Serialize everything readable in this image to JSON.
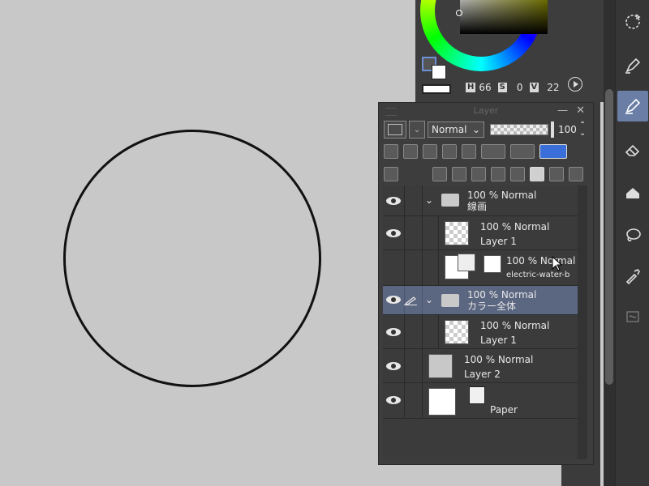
{
  "color_panel": {
    "h_label": "H",
    "h_value": "66",
    "s_label": "S",
    "s_value": "0",
    "v_label": "V",
    "v_value": "22"
  },
  "layer_panel": {
    "title": "Layer",
    "minimize": "—",
    "close": "✕",
    "blend_mode": "Normal",
    "opacity": "100",
    "layers": [
      {
        "opacity_mode": "100 % Normal",
        "name": "線画"
      },
      {
        "opacity_mode": "100 % Normal",
        "name": "Layer 1"
      },
      {
        "opacity_mode": "100 % Normal",
        "name": "electric-water-b"
      },
      {
        "opacity_mode": "100 % Normal",
        "name": "カラー全体"
      },
      {
        "opacity_mode": "100 % Normal",
        "name": "Layer 1"
      },
      {
        "opacity_mode": "100 % Normal",
        "name": "Layer 2"
      },
      {
        "name": "Paper"
      }
    ]
  },
  "toolbar": {
    "tools": [
      "rotate-icon",
      "pen-icon",
      "pencil-icon",
      "eraser-icon",
      "fill-icon",
      "lasso-icon",
      "eyedropper-icon",
      "text-icon"
    ],
    "active_tool": "pencil-icon"
  },
  "colors": {
    "selection": "#5b6680",
    "active_tool": "#6a7ea6",
    "canvas": "#c8c8c8"
  }
}
